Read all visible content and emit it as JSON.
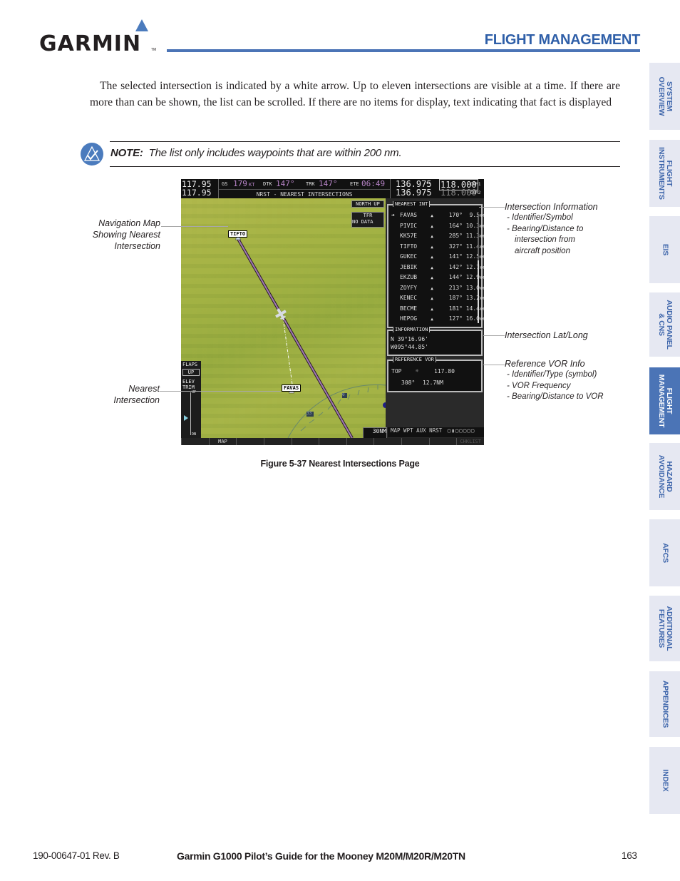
{
  "header": {
    "logo": "GARMIN",
    "logo_tm": "TM",
    "section_title": "FLIGHT MANAGEMENT",
    "accent_color": "#4b74b6"
  },
  "body": {
    "paragraph": "The selected intersection is indicated by a white arrow.  Up to eleven intersections are visible at a time.  If there are more than can be shown, the list can be scrolled.  If there are no items for display, text indicating that fact is displayed"
  },
  "note": {
    "icon": "check-triangle-icon",
    "label": "NOTE:",
    "text": "The list only includes waypoints that are within 200 nm."
  },
  "screen": {
    "nav1": "117.95",
    "nav2": "117.95",
    "gs_label": "GS",
    "gs_value": "179",
    "gs_unit": "KT",
    "dtk_label": "DTK",
    "dtk_value": "147°",
    "trk_label": "TRK",
    "trk_value": "147°",
    "ete_label": "ETE",
    "ete_value": "06:49",
    "page_title": "NRST - NEAREST INTERSECTIONS",
    "com1_active": "136.975",
    "com_swap": "↔",
    "com1_standby": "118.000",
    "com1_label": "COM1",
    "com2_active": "136.975",
    "com2_standby": "118.000",
    "com2_label": "COM2",
    "map": {
      "orientation": "NORTH UP",
      "tfr_label": "TFR",
      "tfr_status": "NO DATA",
      "waypoint_top": "TIFTO",
      "waypoint_nearest": "FAVAS",
      "arc_label_1": "33",
      "arc_label_2": "30",
      "arc_label_3": "0",
      "range": "30NM"
    },
    "flaps": {
      "label": "FLAPS",
      "value": "UP",
      "elev_label": "ELEV",
      "trim_label": "TRIM",
      "up_label": "UP",
      "dn_label": "DN"
    },
    "nearest_int": {
      "title": "NEAREST INT",
      "selected_marker": "➔",
      "rows": [
        {
          "id": "FAVAS",
          "brg": "170°",
          "dist": "9.5",
          "unit": "NM"
        },
        {
          "id": "PIVIC",
          "brg": "164°",
          "dist": "10.3",
          "unit": "NM"
        },
        {
          "id": "KK57E",
          "brg": "285°",
          "dist": "11.3",
          "unit": "NM"
        },
        {
          "id": "TIFTO",
          "brg": "327°",
          "dist": "11.4",
          "unit": "NM"
        },
        {
          "id": "GUKEC",
          "brg": "141°",
          "dist": "12.5",
          "unit": "NM"
        },
        {
          "id": "JEBIK",
          "brg": "142°",
          "dist": "12.7",
          "unit": "NM"
        },
        {
          "id": "EKZUB",
          "brg": "144°",
          "dist": "12.9",
          "unit": "NM"
        },
        {
          "id": "ZOYFY",
          "brg": "213°",
          "dist": "13.0",
          "unit": "NM"
        },
        {
          "id": "KENEC",
          "brg": "187°",
          "dist": "13.2",
          "unit": "NM"
        },
        {
          "id": "BECME",
          "brg": "181°",
          "dist": "14.4",
          "unit": "NM"
        },
        {
          "id": "HEPOG",
          "brg": "127°",
          "dist": "16.0",
          "unit": "NM"
        }
      ]
    },
    "information": {
      "title": "INFORMATION",
      "lat": "N 39°16.96'",
      "lon": "W095°44.85'"
    },
    "reference_vor": {
      "title": "REFERENCE VOR",
      "id": "TOP",
      "symbol": "☼",
      "freq": "117.80",
      "brg": "308°",
      "dist": "12.7NM"
    },
    "page_group": "MAP WPT AUX NRST",
    "softkeys": [
      "",
      "MAP",
      "",
      "",
      "",
      "",
      "",
      "",
      "",
      "",
      "CHKLIST"
    ]
  },
  "callouts": {
    "nav_map": [
      "Navigation Map",
      "Showing Nearest",
      "Intersection"
    ],
    "nearest": [
      "Nearest",
      "Intersection"
    ],
    "int_info": {
      "title": "Intersection Information",
      "items": [
        "- Identifier/Symbol",
        "- Bearing/Distance to",
        "intersection from",
        "aircraft position"
      ]
    },
    "lat_long": "Intersection Lat/Long",
    "ref_vor": {
      "title": "Reference VOR Info",
      "items": [
        "- Identifier/Type (symbol)",
        "- VOR Frequency",
        "- Bearing/Distance to VOR"
      ]
    }
  },
  "caption": "Figure 5-37  Nearest Intersections Page",
  "side_tabs": [
    {
      "label": "SYSTEM\nOVERVIEW",
      "active": false
    },
    {
      "label": "FLIGHT\nINSTRUMENTS",
      "active": false
    },
    {
      "label": "EIS",
      "active": false
    },
    {
      "label": "AUDIO PANEL\n& CNS",
      "active": false
    },
    {
      "label": "FLIGHT\nMANAGEMENT",
      "active": true
    },
    {
      "label": "HAZARD\nAVOIDANCE",
      "active": false
    },
    {
      "label": "AFCS",
      "active": false
    },
    {
      "label": "ADDITIONAL\nFEATURES",
      "active": false
    },
    {
      "label": "APPENDICES",
      "active": false
    },
    {
      "label": "INDEX",
      "active": false
    }
  ],
  "footer": {
    "doc_number": "190-00647-01  Rev. B",
    "title": "Garmin G1000 Pilot’s Guide for the Mooney M20M/M20R/M20TN",
    "page": "163"
  }
}
